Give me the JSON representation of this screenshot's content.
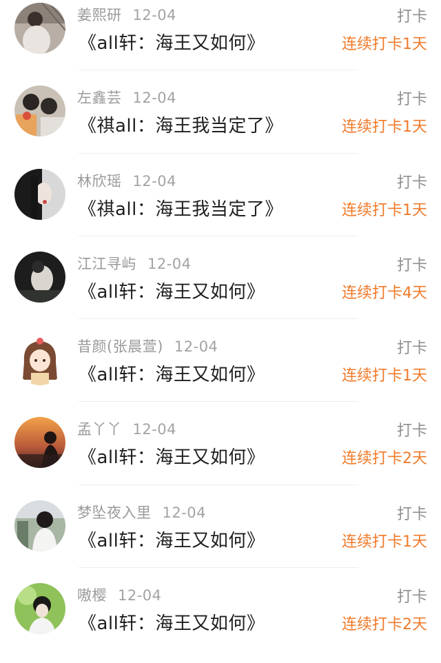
{
  "posts": [
    {
      "user": "姜熙研",
      "date": "12-04",
      "title": "《all轩：海王又如何》",
      "action": "打卡",
      "streak": "连续打卡1天",
      "avatar_icon": "avatar-girl-photo"
    },
    {
      "user": "左鑫芸",
      "date": "12-04",
      "title": "《祺all：海王我当定了》",
      "action": "打卡",
      "streak": "连续打卡1天",
      "avatar_icon": "avatar-boys-photo"
    },
    {
      "user": "林欣瑶",
      "date": "12-04",
      "title": "《祺all：海王我当定了》",
      "action": "打卡",
      "streak": "连续打卡1天",
      "avatar_icon": "avatar-woman-profile"
    },
    {
      "user": "江江寻屿",
      "date": "12-04",
      "title": "《all轩：海王又如何》",
      "action": "打卡",
      "streak": "连续打卡4天",
      "avatar_icon": "avatar-dark-photo"
    },
    {
      "user": "昔颜(张晨萱)",
      "date": "12-04",
      "title": "《all轩：海王又如何》",
      "action": "打卡",
      "streak": "连续打卡1天",
      "avatar_icon": "avatar-cartoon-girl"
    },
    {
      "user": "孟丫丫",
      "date": "12-04",
      "title": "《all轩：海王又如何》",
      "action": "打卡",
      "streak": "连续打卡2天",
      "avatar_icon": "avatar-sunset-photo"
    },
    {
      "user": "梦坠夜入里",
      "date": "12-04",
      "title": "《all轩：海王又如何》",
      "action": "打卡",
      "streak": "连续打卡1天",
      "avatar_icon": "avatar-girl-outdoor"
    },
    {
      "user": "嗷樱",
      "date": "12-04",
      "title": "《all轩：海王又如何》",
      "action": "打卡",
      "streak": "连续打卡2天",
      "avatar_icon": "avatar-boy-green"
    }
  ],
  "colors": {
    "streak": "#f07a2a",
    "username": "#9a9a9a",
    "title": "#1e1e1e"
  }
}
